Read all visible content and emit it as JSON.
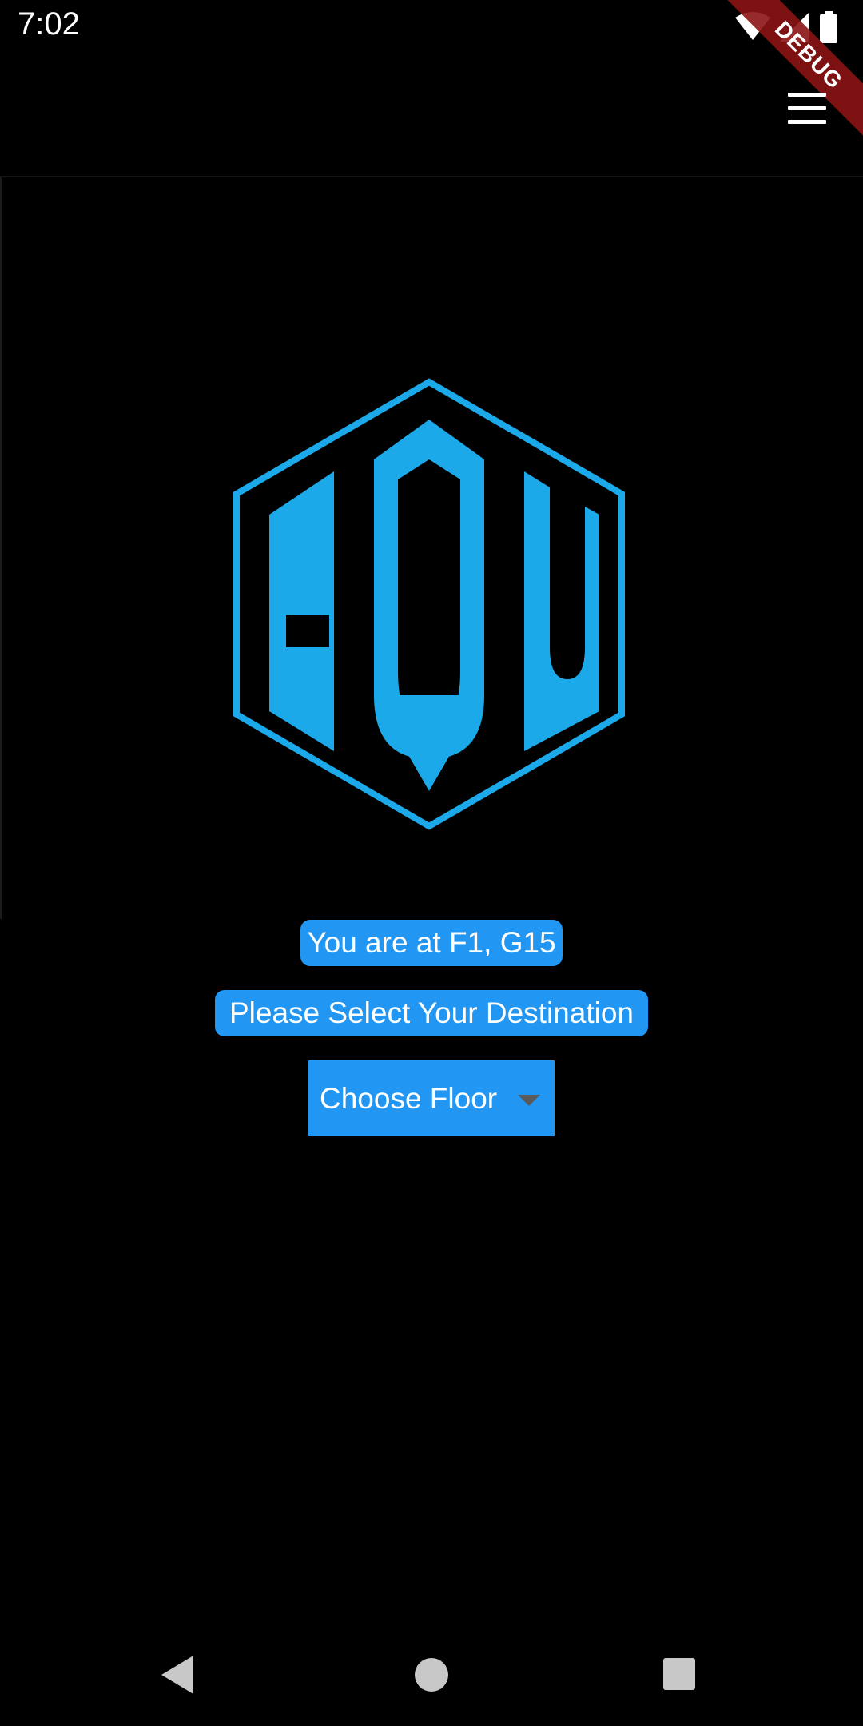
{
  "status_bar": {
    "time": "7:02",
    "icons": [
      "wifi-icon",
      "cell-signal-icon",
      "battery-icon"
    ]
  },
  "debug_banner": {
    "label": "DEBUG"
  },
  "app_bar": {
    "menu_icon": "hamburger-menu-icon"
  },
  "logo": {
    "text": "ADU",
    "color": "#1ba9e9"
  },
  "main": {
    "location_text": "You are at F1, G15",
    "prompt_text": "Please Select Your Destination",
    "floor_dropdown": {
      "selected_label": "Choose Floor",
      "icon": "dropdown-arrow-icon"
    }
  },
  "nav_bar": {
    "icons": [
      "back-icon",
      "home-icon",
      "recents-icon"
    ]
  },
  "colors": {
    "accent": "#2196f3",
    "background": "#000000",
    "logo": "#1ba9e9",
    "debug_banner": "#8c1414"
  }
}
